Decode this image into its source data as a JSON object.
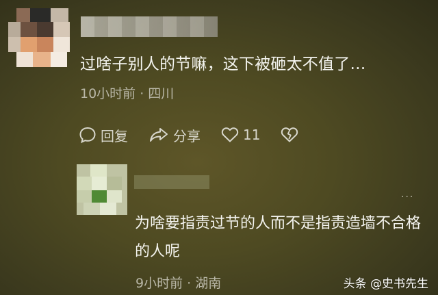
{
  "comment": {
    "text": "过啥子别人的节嘛，这下被砸太不值了…",
    "meta": "10小时前 · 四川",
    "actions": {
      "reply_label": "回复",
      "share_label": "分享",
      "like_count": "11"
    }
  },
  "reply": {
    "text": "为啥要指责过节的人而不是指责造墙不合格的人呢",
    "meta": "9小时前 · 湖南",
    "more": "···"
  },
  "watermark": "头条 @史书先生",
  "colors": {
    "background": "#4e4a22",
    "text": "#f4f4ef",
    "meta": "#b9b7a7"
  }
}
